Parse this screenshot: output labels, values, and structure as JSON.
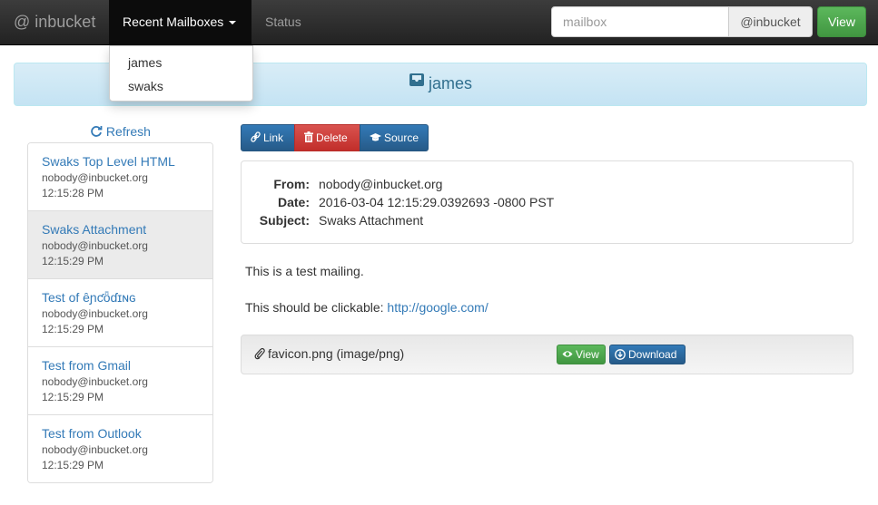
{
  "navbar": {
    "brand": "@ inbucket",
    "recent_mailboxes_label": "Recent Mailboxes",
    "status_label": "Status",
    "search_placeholder": "mailbox",
    "domain_addon": "@inbucket",
    "view_label": "View"
  },
  "dropdown": {
    "items": [
      "james",
      "swaks"
    ]
  },
  "mailbox": {
    "name": "james"
  },
  "sidebar": {
    "refresh_label": "Refresh",
    "messages": [
      {
        "subject": "Swaks Top Level HTML",
        "from": "nobody@inbucket.org",
        "time": "12:15:28 PM"
      },
      {
        "subject": "Swaks Attachment",
        "from": "nobody@inbucket.org",
        "time": "12:15:29 PM"
      },
      {
        "subject": "Test of ȇɲƈȫɗɪɴɢ",
        "from": "nobody@inbucket.org",
        "time": "12:15:29 PM"
      },
      {
        "subject": "Test from Gmail",
        "from": "nobody@inbucket.org",
        "time": "12:15:29 PM"
      },
      {
        "subject": "Test from Outlook",
        "from": "nobody@inbucket.org",
        "time": "12:15:29 PM"
      }
    ]
  },
  "toolbar": {
    "link_label": "Link",
    "delete_label": "Delete",
    "source_label": "Source"
  },
  "message": {
    "from_label": "From:",
    "from": "nobody@inbucket.org",
    "date_label": "Date:",
    "date": "2016-03-04 12:15:29.0392693 -0800 PST",
    "subject_label": "Subject:",
    "subject": "Swaks Attachment",
    "body_line1": "This is a test mailing.",
    "body_line2_prefix": "This should be clickable:",
    "body_link": "http://google.com/"
  },
  "attachment": {
    "name": "favicon.png (image/png)",
    "view_label": "View",
    "download_label": "Download"
  },
  "colors": {
    "navbar": "#222222",
    "link": "#337ab7",
    "success": "#5cb85c",
    "danger": "#d9534f",
    "info_bg": "#d9edf7"
  }
}
